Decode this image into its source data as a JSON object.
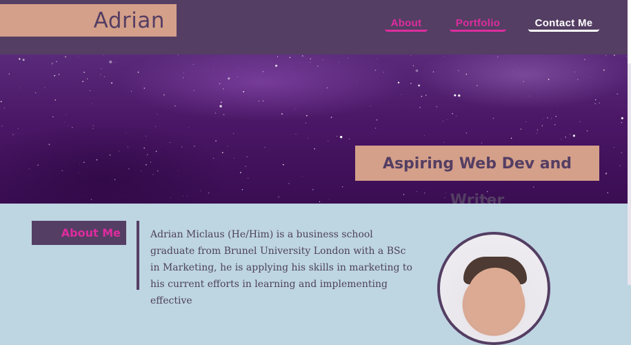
{
  "header": {
    "brand": "Adrian",
    "nav": [
      {
        "label": "About"
      },
      {
        "label": "Portfolio"
      },
      {
        "label": "Contact Me"
      }
    ]
  },
  "hero": {
    "tagline": "Aspiring Web Dev and Writer"
  },
  "about": {
    "heading": "About Me",
    "text": "Adrian Miclaus (He/Him) is a business school graduate from Brunel University London with a BSc in Marketing, he is applying his skills in marketing to his current efforts in learning and implementing effective"
  },
  "colors": {
    "header_bg": "#543e63",
    "accent_peach": "#d4a08a",
    "nav_pink": "#de2c9f",
    "page_bg": "#bed5e2"
  }
}
